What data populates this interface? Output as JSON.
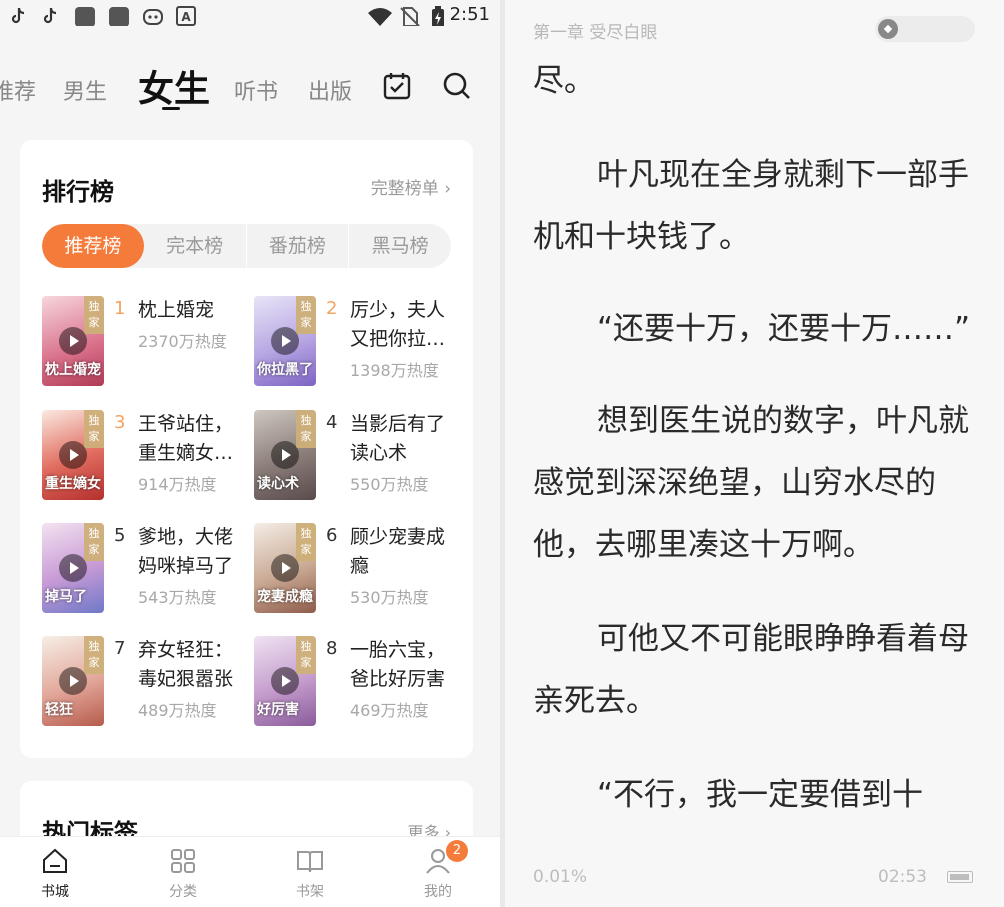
{
  "status_bar": {
    "time": "2:51",
    "icons": [
      "tiktok-icon",
      "tiktok-icon",
      "app-square-icon",
      "app-square-icon",
      "game-pad-icon",
      "font-a-icon",
      "wifi-icon",
      "no-sim-icon",
      "battery-charging-icon"
    ]
  },
  "top_nav": {
    "tabs": [
      {
        "label": "推荐",
        "active": false
      },
      {
        "label": "男生",
        "active": false
      },
      {
        "label": "女生",
        "active": true
      },
      {
        "label": "听书",
        "active": false
      },
      {
        "label": "出版",
        "active": false
      }
    ],
    "icons": [
      "calendar-check-icon",
      "search-icon"
    ]
  },
  "rank_card": {
    "title": "排行榜",
    "more": "完整榜单 ›",
    "tabs": [
      {
        "label": "推荐榜",
        "active": true
      },
      {
        "label": "完本榜",
        "active": false
      },
      {
        "label": "番茄榜",
        "active": false
      },
      {
        "label": "黑马榜",
        "active": false
      }
    ],
    "badge": "独家",
    "books": [
      {
        "rank": "1",
        "title": "枕上婚宠",
        "heat": "2370万热度",
        "cover_text": "枕上婚宠"
      },
      {
        "rank": "2",
        "title": "厉少，夫人又把你拉…",
        "heat": "1398万热度",
        "cover_text": "你拉黑了"
      },
      {
        "rank": "3",
        "title": "王爷站住，重生嫡女…",
        "heat": "914万热度",
        "cover_text": "重生嫡女"
      },
      {
        "rank": "4",
        "title": "当影后有了读心术",
        "heat": "550万热度",
        "cover_text": "读心术"
      },
      {
        "rank": "5",
        "title": "爹地，大佬妈咪掉马了",
        "heat": "543万热度",
        "cover_text": "掉马了"
      },
      {
        "rank": "6",
        "title": "顾少宠妻成瘾",
        "heat": "530万热度",
        "cover_text": "宠妻成瘾"
      },
      {
        "rank": "7",
        "title": "弃女轻狂：毒妃狠嚣张",
        "heat": "489万热度",
        "cover_text": "轻狂"
      },
      {
        "rank": "8",
        "title": "一胎六宝，爸比好厉害",
        "heat": "469万热度",
        "cover_text": "好厉害"
      }
    ],
    "rank_colors": {
      "top": "#f4a460",
      "rest": "#333333"
    }
  },
  "tag_card": {
    "title": "热门标签",
    "more": "更多 ›"
  },
  "bottom_nav": {
    "items": [
      {
        "label": "书城",
        "active": true
      },
      {
        "label": "分类",
        "active": false
      },
      {
        "label": "书架",
        "active": false
      },
      {
        "label": "我的",
        "active": false,
        "badge": "2"
      }
    ]
  },
  "reader": {
    "chapter_title": "第一章 受尽白眼",
    "paragraphs": [
      "尽。",
      "叶凡现在全身就剩下一部手机和十块钱了。",
      "“还要十万，还要十万……”",
      "想到医生说的数字，叶凡就感觉到深深绝望，山穷水尽的他，去哪里凑这十万啊。",
      "可他又不可能眼睁睁看着母亲死去。",
      "“不行，我一定要借到十"
    ],
    "progress": "0.01%",
    "time": "02:53"
  },
  "colors": {
    "accent": "#f47b3a",
    "badge_gold": "#cdaf78"
  }
}
